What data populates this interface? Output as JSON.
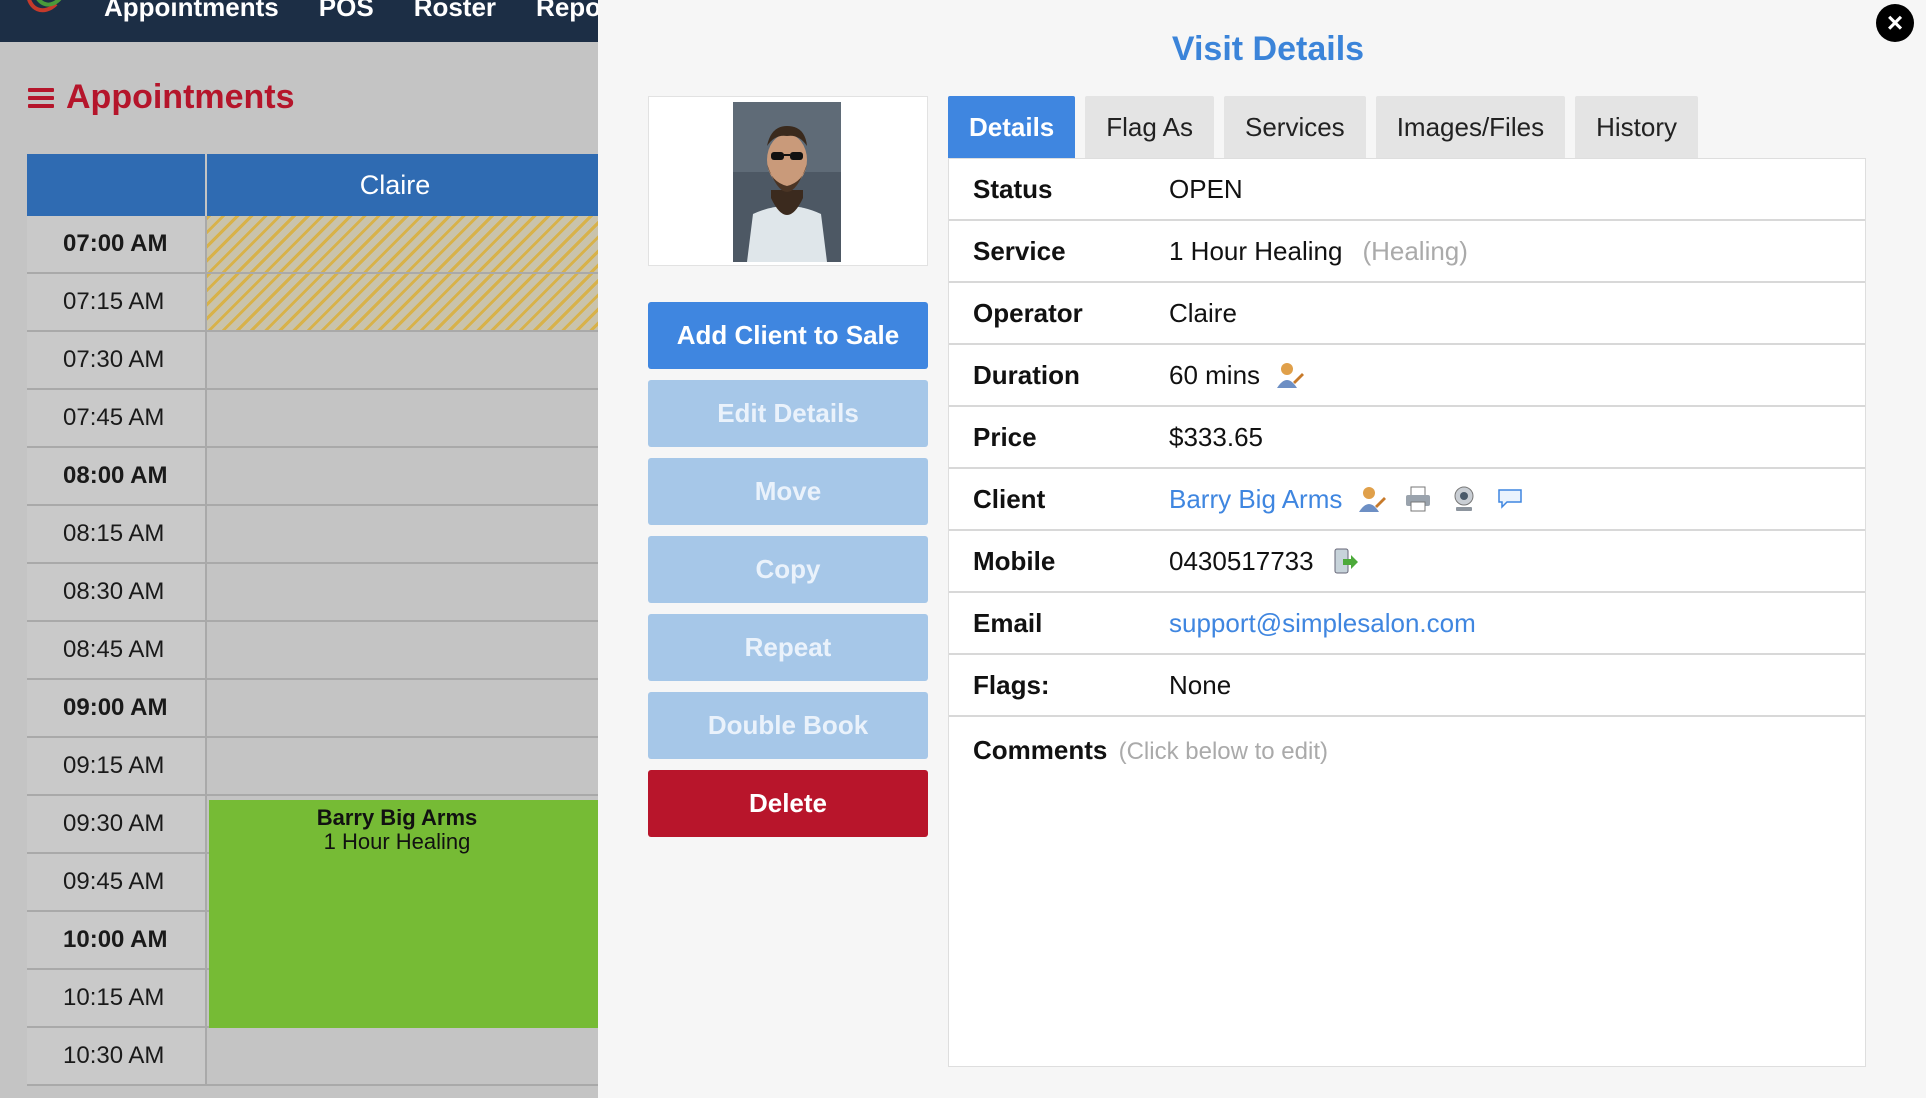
{
  "background_app": {
    "nav_items": [
      "Appointments",
      "POS",
      "Roster",
      "Repo"
    ],
    "page_title": "Appointments",
    "staff_column": "Claire",
    "time_slots": [
      {
        "time": "07:00 AM",
        "hour": true,
        "striped": true
      },
      {
        "time": "07:15 AM",
        "hour": false,
        "striped": true
      },
      {
        "time": "07:30 AM",
        "hour": false,
        "striped": false
      },
      {
        "time": "07:45 AM",
        "hour": false,
        "striped": false
      },
      {
        "time": "08:00 AM",
        "hour": true,
        "striped": false
      },
      {
        "time": "08:15 AM",
        "hour": false,
        "striped": false
      },
      {
        "time": "08:30 AM",
        "hour": false,
        "striped": false
      },
      {
        "time": "08:45 AM",
        "hour": false,
        "striped": false
      },
      {
        "time": "09:00 AM",
        "hour": true,
        "striped": false
      },
      {
        "time": "09:15 AM",
        "hour": false,
        "striped": false
      },
      {
        "time": "09:30 AM",
        "hour": false,
        "striped": false
      },
      {
        "time": "09:45 AM",
        "hour": false,
        "striped": false
      },
      {
        "time": "10:00 AM",
        "hour": true,
        "striped": false
      },
      {
        "time": "10:15 AM",
        "hour": false,
        "striped": false
      },
      {
        "time": "10:30 AM",
        "hour": false,
        "striped": false
      }
    ],
    "appointment": {
      "client": "Barry Big Arms",
      "service": "1 Hour Healing",
      "color": "#76bb35"
    }
  },
  "modal": {
    "title": "Visit Details",
    "close_label": "×",
    "buttons": {
      "add_client_to_sale": "Add Client to Sale",
      "edit_details": "Edit Details",
      "move": "Move",
      "copy": "Copy",
      "repeat": "Repeat",
      "double_book": "Double Book",
      "delete": "Delete"
    },
    "tabs": [
      {
        "label": "Details",
        "active": true
      },
      {
        "label": "Flag As",
        "active": false
      },
      {
        "label": "Services",
        "active": false
      },
      {
        "label": "Images/Files",
        "active": false
      },
      {
        "label": "History",
        "active": false
      }
    ],
    "details": {
      "status_label": "Status",
      "status_value": "OPEN",
      "service_label": "Service",
      "service_value": "1 Hour Healing",
      "service_category": "(Healing)",
      "operator_label": "Operator",
      "operator_value": "Claire",
      "duration_label": "Duration",
      "duration_value": "60 mins",
      "price_label": "Price",
      "price_value": "$333.65",
      "client_label": "Client",
      "client_value": "Barry Big Arms",
      "mobile_label": "Mobile",
      "mobile_value": "0430517733",
      "email_label": "Email",
      "email_value": "support@simplesalon.com",
      "flags_label": "Flags:",
      "flags_value": "None",
      "comments_label": "Comments",
      "comments_hint": "(Click below to edit)"
    },
    "icons": {
      "duration": "user-edit-icon",
      "client": [
        "user-edit-icon",
        "print-icon",
        "webcam-icon",
        "chat-bubble-icon"
      ],
      "mobile": "sms-icon"
    }
  },
  "colors": {
    "accent_blue": "#3f86e0",
    "danger_red": "#b8152b",
    "heading_red": "#b5152b",
    "calendar_header": "#2f6bb2"
  }
}
